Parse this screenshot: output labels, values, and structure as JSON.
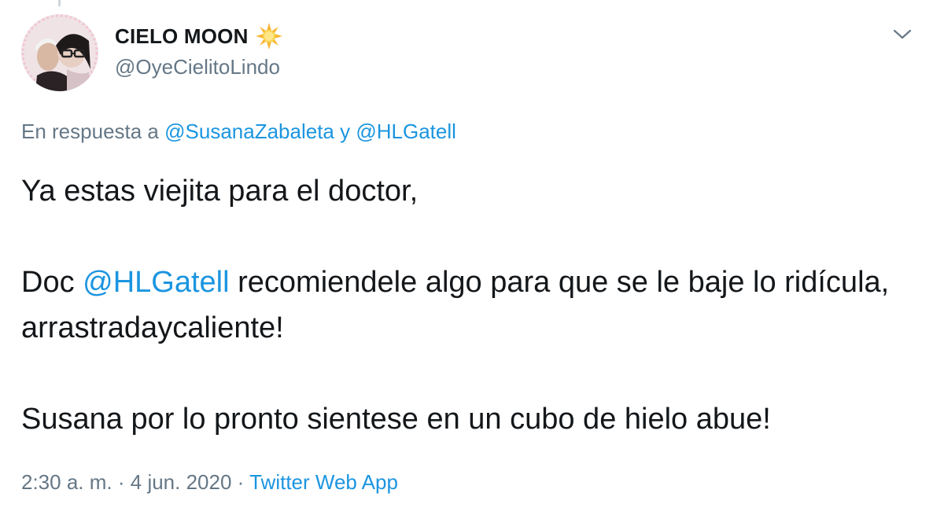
{
  "author": {
    "display_name": "CIELO MOON",
    "emoji_icon": "sun-emoji-icon",
    "handle": "@OyeCielitoLindo"
  },
  "reply": {
    "prefix": "En respuesta a",
    "user1": "@SusanaZabaleta",
    "conjunction": "y",
    "user2": "@HLGatell"
  },
  "tweet": {
    "line1": "Ya estas viejita para el doctor,",
    "line2_prefix": "Doc",
    "line2_mention": "@HLGatell",
    "line2_suffix": "recomiendele algo para que se le baje lo ridícula, arrastradaycaliente!",
    "line3": "Susana por lo pronto sientese en un cubo de hielo abue!"
  },
  "meta": {
    "time": "2:30 a. m.",
    "separator1": "·",
    "date": "4 jun. 2020",
    "separator2": "·",
    "source": "Twitter Web App"
  },
  "colors": {
    "link": "#1b95e0",
    "secondary_text": "#657786",
    "primary_text": "#14171a"
  }
}
